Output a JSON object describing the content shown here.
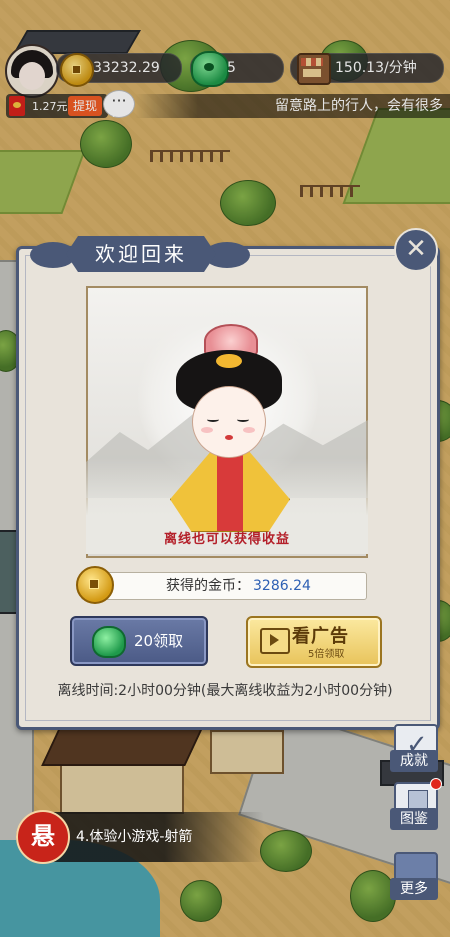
{
  "hud": {
    "coins": "33232.29",
    "jade": "5",
    "income_rate": "150.13/分钟",
    "redpacket_amount": "1.27元",
    "withdraw_label": "提现",
    "chat_icon_glyph": "···",
    "ticker_text": "留意路上的行人，会有很多"
  },
  "dialog": {
    "title": "欢迎回来",
    "close_glyph": "✕",
    "art_caption": "离线也可以获得收益",
    "earned_label": "获得的金币：",
    "earned_value": "3286.24",
    "claim_button_label": "20领取",
    "ad_button_label": "看广告",
    "ad_button_sub": "5倍领取",
    "offline_text": "离线时间:2小时00分钟(最大离线收益为2小时00分钟)"
  },
  "side": {
    "achievement_label": "成就",
    "collection_label": "图鉴",
    "more_label": "更多"
  },
  "quest": {
    "seal_char": "悬",
    "text": "4.体验小游戏-射箭"
  },
  "colors": {
    "dialog_frame": "#4a5877",
    "dialog_bg": "#e8e3da",
    "earned_value": "#2d5fb3",
    "caption": "#b4202a"
  }
}
